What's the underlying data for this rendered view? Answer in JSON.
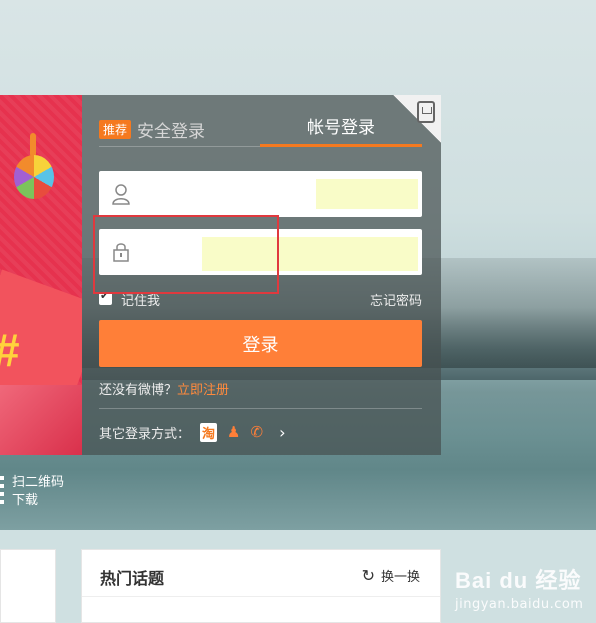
{
  "login": {
    "tab_recommend_badge": "推荐",
    "tab_secure_label": "安全登录",
    "tab_account_label": "帐号登录",
    "username_value": "",
    "password_value": "",
    "remember_label": "记住我",
    "forgot_label": "忘记密码",
    "login_button_label": "登录",
    "signup_prompt": "还没有微博？",
    "signup_link": "立即注册",
    "other_login_label": "其它登录方式：",
    "other_icons": [
      "taobao-icon",
      "qq-icon",
      "weibo-icon"
    ],
    "more_glyph": "›"
  },
  "qr": {
    "line1": "扫二维码",
    "line2": "下载"
  },
  "hot_topics": {
    "title": "热门话题",
    "refresh_label": "换一换"
  },
  "watermark": {
    "brand": "Bai du 经验",
    "sub": "jingyan.baidu.com"
  },
  "colors": {
    "accent": "#ff7f38",
    "highlight_box": "#e0393e",
    "banner": "#e6324e"
  }
}
